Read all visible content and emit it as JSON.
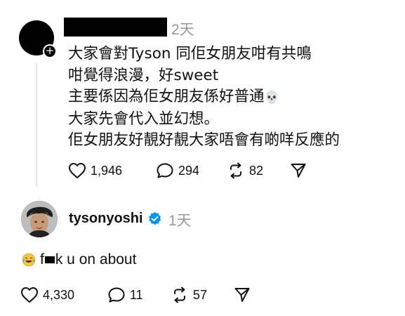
{
  "post": {
    "time": "2天",
    "lines": [
      "大家會對Tyson 同佢女朋友咁有共鳴",
      "咁覺得浪漫，好sweet",
      "主要係因為佢女朋友係好普通",
      "大家先會代入並幻想。",
      "佢女朋友好靚好靚大家唔會有啲咩反應的"
    ],
    "skull_emoji": "💀",
    "likes": "1,946",
    "comments": "294",
    "reposts": "82"
  },
  "reply": {
    "username": "tysonyoshi",
    "time": "1天",
    "text_start": "f",
    "text_end": "k u on about",
    "likes": "4,330",
    "comments": "11",
    "reposts": "57"
  },
  "icons": {
    "avatar_badge": "plus-icon",
    "verified": "verified-badge-icon",
    "like": "heart-icon",
    "comment": "comment-bubble-icon",
    "repost": "repost-icon",
    "share": "send-icon",
    "reply_emoji": "face-with-tears-of-joy-icon"
  },
  "colors": {
    "verified_blue": "#0095f6",
    "muted_text": "#9a9a9a"
  }
}
